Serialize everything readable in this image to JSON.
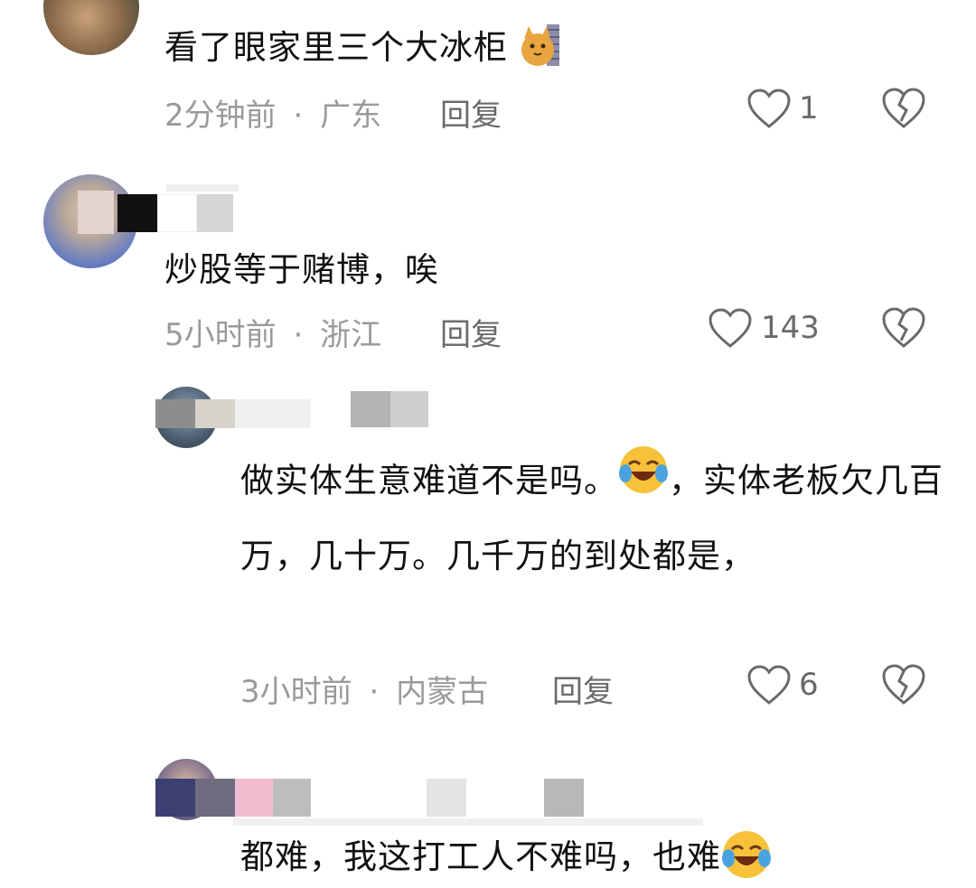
{
  "comments": [
    {
      "text": "看了眼家里三个大冰柜",
      "time": "2分钟前",
      "separator": "·",
      "location": "广东",
      "reply_label": "回复",
      "likes": "1",
      "emoji_icon": "cat-face-icon"
    },
    {
      "text": "炒股等于赌博，唉",
      "time": "5小时前",
      "separator": "·",
      "location": "浙江",
      "reply_label": "回复",
      "likes": "143"
    },
    {
      "text_part1": "做实体生意难道不是吗。",
      "text_part2": "，实体老板欠几百万，几十万。几千万的到处都是，",
      "time": "3小时前",
      "separator": "·",
      "location": "内蒙古",
      "reply_label": "回复",
      "likes": "6",
      "emoji_icon": "laughing-crying-emoji-icon"
    },
    {
      "text": "都难，我这打工人不难吗，也难",
      "emoji_icon": "laughing-crying-emoji-icon"
    }
  ],
  "icons": {
    "like": "heart-outline-icon",
    "dislike": "broken-heart-icon"
  },
  "colors": {
    "text": "#111111",
    "meta": "#9a9a9a",
    "action": "#6a6a6a"
  }
}
